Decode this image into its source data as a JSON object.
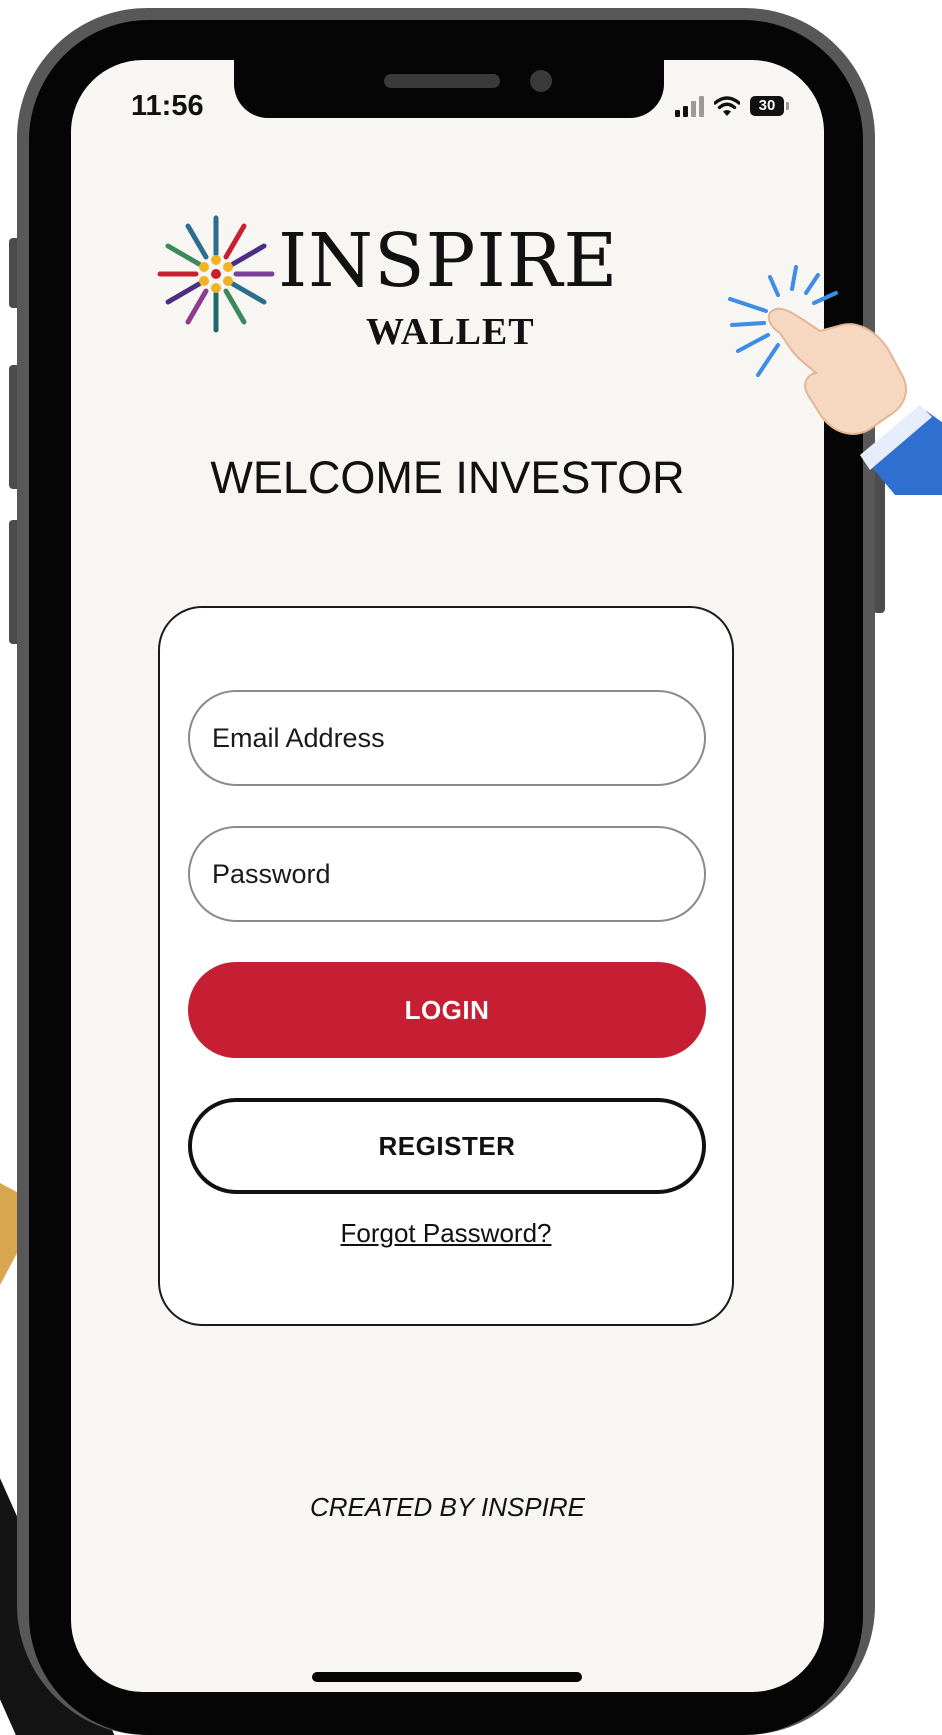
{
  "status_bar": {
    "time": "11:56",
    "battery": "30"
  },
  "brand": {
    "name": "INSPIRE",
    "sub": "WALLET"
  },
  "welcome_title": "WELCOME INVESTOR",
  "login_form": {
    "email_placeholder": "Email Address",
    "password_placeholder": "Password",
    "login_label": "LOGIN",
    "register_label": "REGISTER",
    "forgot_label": "Forgot Password?"
  },
  "footer": {
    "credit": "CREATED BY INSPIRE"
  },
  "colors": {
    "accent_red": "#c61f33",
    "screen_bg": "#f7f6f2",
    "decor_gold": "#d8a64f"
  },
  "icons": [
    "cellular-signal-icon",
    "wifi-icon",
    "battery-icon",
    "inspire-logo-icon",
    "pointing-hand-icon"
  ]
}
